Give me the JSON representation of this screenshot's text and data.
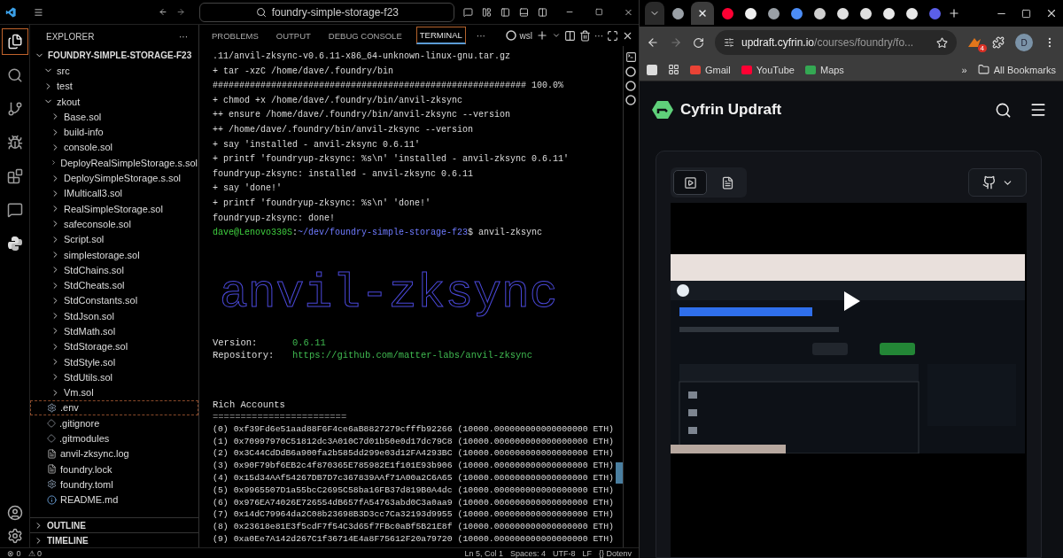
{
  "vscode": {
    "command_center": "foundry-simple-storage-f23",
    "activity_bar": [
      {
        "kind": "files",
        "selected": true
      },
      {
        "kind": "search",
        "selected": false
      },
      {
        "kind": "source-control",
        "selected": false
      },
      {
        "kind": "run-debug",
        "selected": false
      },
      {
        "kind": "extensions",
        "selected": false
      },
      {
        "kind": "chat",
        "selected": false
      },
      {
        "kind": "python",
        "selected": false
      }
    ],
    "explorer": {
      "title": "EXPLORER",
      "more": "···",
      "root": {
        "label": "FOUNDRY-SIMPLE-STORAGE-F23",
        "expanded": true,
        "children": [
          {
            "label": "src",
            "expanded": true
          },
          {
            "label": "test",
            "expanded": false
          },
          {
            "label": "zkout",
            "expanded": true,
            "children": [
              {
                "label": "Base.sol",
                "expanded": false
              },
              {
                "label": "build-info",
                "expanded": false
              },
              {
                "label": "console.sol",
                "expanded": false
              },
              {
                "label": "DeployRealSimpleStorage.s.sol",
                "expanded": false
              },
              {
                "label": "DeploySimpleStorage.s.sol",
                "expanded": false
              },
              {
                "label": "IMulticall3.sol",
                "expanded": false
              },
              {
                "label": "RealSimpleStorage.sol",
                "expanded": false
              },
              {
                "label": "safeconsole.sol",
                "expanded": false
              },
              {
                "label": "Script.sol",
                "expanded": false
              },
              {
                "label": "simplestorage.sol",
                "expanded": false
              },
              {
                "label": "StdChains.sol",
                "expanded": false
              },
              {
                "label": "StdCheats.sol",
                "expanded": false
              },
              {
                "label": "StdConstants.sol",
                "expanded": false
              },
              {
                "label": "StdJson.sol",
                "expanded": false
              },
              {
                "label": "StdMath.sol",
                "expanded": false
              },
              {
                "label": "StdStorage.sol",
                "expanded": false
              },
              {
                "label": "StdStyle.sol",
                "expanded": false
              },
              {
                "label": "StdUtils.sol",
                "expanded": false
              },
              {
                "label": "Vm.sol",
                "expanded": false
              }
            ]
          },
          {
            "label": ".env",
            "kind": "settings",
            "selected": true
          },
          {
            "label": ".gitignore",
            "kind": "git",
            "selected": false
          },
          {
            "label": ".gitmodules",
            "kind": "git",
            "selected": false
          },
          {
            "label": "anvil-zksync.log",
            "kind": "text",
            "selected": false
          },
          {
            "label": "foundry.lock",
            "kind": "text",
            "selected": false
          },
          {
            "label": "foundry.toml",
            "kind": "settings",
            "selected": false
          },
          {
            "label": "README.md",
            "kind": "info",
            "selected": false
          }
        ]
      },
      "sections": [
        {
          "label": "OUTLINE",
          "expanded": false
        },
        {
          "label": "TIMELINE",
          "expanded": false
        }
      ]
    },
    "panel_tabs": [
      {
        "label": "PROBLEMS",
        "selected": false
      },
      {
        "label": "OUTPUT",
        "selected": false
      },
      {
        "label": "DEBUG CONSOLE",
        "selected": false
      },
      {
        "label": "TERMINAL",
        "selected": true
      }
    ],
    "panel_more": "···",
    "terminal_profile": "wsl",
    "terminal": {
      "log": [
        ".11/anvil-zksync-v0.6.11-x86_64-unknown-linux-gnu.tar.gz",
        "+ tar -xzC /home/dave/.foundry/bin",
        "########################################################### 100.0%",
        "+ chmod +x /home/dave/.foundry/bin/anvil-zksync",
        "++ ensure /home/dave/.foundry/bin/anvil-zksync --version",
        "++ /home/dave/.foundry/bin/anvil-zksync --version",
        "+ say 'installed - anvil-zksync 0.6.11'",
        "+ printf 'foundryup-zksync: %s\\n' 'installed - anvil-zksync 0.6.11'",
        "foundryup-zksync: installed - anvil-zksync 0.6.11",
        "+ say 'done!'",
        "+ printf 'foundryup-zksync: %s\\n' 'done!'",
        "foundryup-zksync: done!"
      ],
      "prompt": {
        "user": "dave@Lenovo330S",
        "separator": ":",
        "path": "~/dev/foundry-simple-storage-f23",
        "command": "$ anvil-zksync"
      },
      "banner": "anvil-zksync",
      "info": [
        {
          "label": "Version:",
          "value": "0.6.11"
        },
        {
          "label": "Repository:",
          "value": "https://github.com/matter-labs/anvil-zksync"
        }
      ],
      "accounts_title": "Rich Accounts",
      "accounts_rule": "========================",
      "accounts": [
        {
          "index": "(0)",
          "address": "0xf39Fd6e51aad88F6F4ce6aB8827279cfffb92266",
          "balance": "(10000.000000000000000000 ETH)"
        },
        {
          "index": "(1)",
          "address": "0x70997970C51812dc3A010C7d01b50e0d17dc79C8",
          "balance": "(10000.000000000000000000 ETH)"
        },
        {
          "index": "(2)",
          "address": "0x3C44CdDdB6a900fa2b585dd299e03d12FA4293BC",
          "balance": "(10000.000000000000000000 ETH)"
        },
        {
          "index": "(3)",
          "address": "0x90F79bf6EB2c4f870365E785982E1f101E93b906",
          "balance": "(10000.000000000000000000 ETH)"
        },
        {
          "index": "(4)",
          "address": "0x15d34AAf54267DB7D7c367839AAf71A00a2C6A65",
          "balance": "(10000.000000000000000000 ETH)"
        },
        {
          "index": "(5)",
          "address": "0x9965507D1a55bcC2695C58ba16FB37d819B0A4dc",
          "balance": "(10000.000000000000000000 ETH)"
        },
        {
          "index": "(6)",
          "address": "0x976EA74026E726554dB657fA54763abd0C3a0aa9",
          "balance": "(10000.000000000000000000 ETH)"
        },
        {
          "index": "(7)",
          "address": "0x14dC79964da2C08b23698B3D3cc7Ca32193d9955",
          "balance": "(10000.000000000000000000 ETH)"
        },
        {
          "index": "(8)",
          "address": "0x23618e81E3f5cdF7f54C3d65f7FBc0aBf5B21E8f",
          "balance": "(10000.000000000000000000 ETH)"
        },
        {
          "index": "(9)",
          "address": "0xa0Ee7A142d267C1f36714E4a8F75612F20a79720",
          "balance": "(10000.000000000000000000 ETH)"
        }
      ]
    },
    "status_bar": {
      "error_icon": "⊗",
      "errors": "0",
      "warning_icon": "⚠",
      "warnings": "0",
      "items": [
        "Ln 5, Col 1",
        "Spaces: 4",
        "UTF-8",
        "LF",
        "{} Dotenv"
      ]
    }
  },
  "browser": {
    "tabs": [
      {
        "color": "#9aa0a6",
        "selected": false
      },
      {
        "color": "#e8eaed",
        "selected": true
      },
      {
        "color": "#ff0033",
        "selected": false
      },
      {
        "color": "#f0f0f0",
        "selected": false
      },
      {
        "color": "#9aa0a6",
        "selected": false
      },
      {
        "color": "#4c8df6",
        "selected": false
      },
      {
        "color": "#d0d0d0",
        "selected": false
      },
      {
        "color": "#e0e0e0",
        "selected": false
      },
      {
        "color": "#e0e0e0",
        "selected": false
      },
      {
        "color": "#e8e8e8",
        "selected": false
      },
      {
        "color": "#e8e8e8",
        "selected": false
      },
      {
        "color": "#5b5fe8",
        "selected": false
      }
    ],
    "url_host": "updraft.cyfrin.io",
    "url_path": "/courses/foundry/fo...",
    "extension_badge": "4",
    "profile": "D",
    "bookmarks": [
      {
        "label": "Gmail",
        "color": "#ea4335"
      },
      {
        "label": "YouTube",
        "color": "#ff0033"
      },
      {
        "label": "Maps",
        "color": "#34a853"
      }
    ],
    "bookmarks_more": "»",
    "all_bookmarks": "All Bookmarks",
    "site_title": "Cyfrin Updraft",
    "view_toggle": [
      {
        "kind": "video",
        "selected": true
      },
      {
        "kind": "text",
        "selected": false
      }
    ]
  }
}
